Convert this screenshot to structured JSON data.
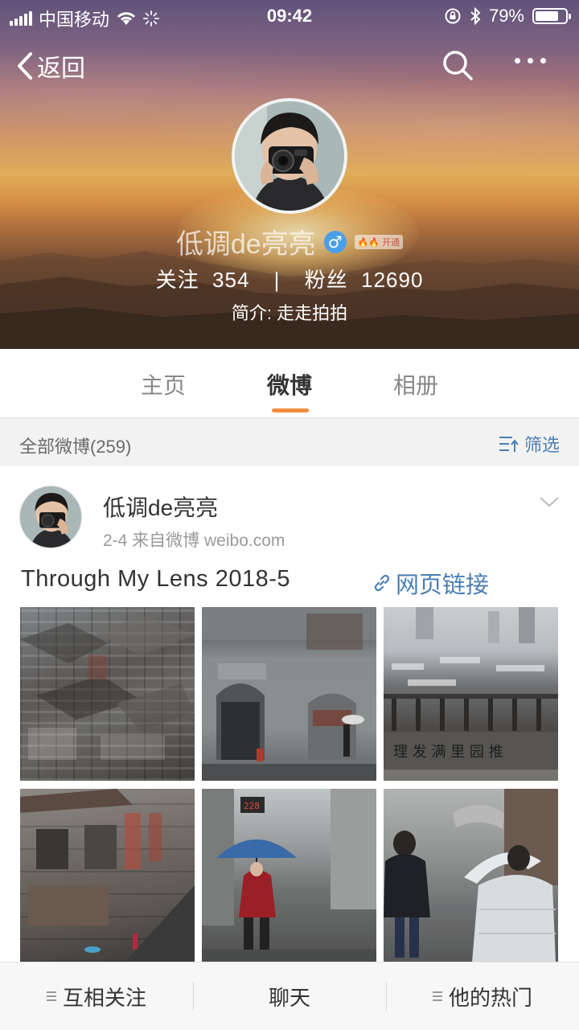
{
  "status_bar": {
    "carrier": "中国移动",
    "time": "09:42",
    "battery_percent": "79%",
    "battery_level": 0.79
  },
  "nav": {
    "back_label": "返回",
    "search_icon": "search-icon",
    "more_icon": "more-icon"
  },
  "profile": {
    "name": "低调de亮亮",
    "gender_symbol": "♂",
    "level_badge": "🔥🔥 开通",
    "following_label": "关注",
    "following_count": "354",
    "separator": "|",
    "followers_label": "粉丝",
    "followers_count": "12690",
    "bio": "简介: 走走拍拍"
  },
  "tabs": [
    {
      "label": "主页",
      "active": false
    },
    {
      "label": "微博",
      "active": true
    },
    {
      "label": "相册",
      "active": false
    }
  ],
  "filter": {
    "count_label": "全部微博(259)",
    "filter_label": "筛选"
  },
  "post": {
    "author": "低调de亮亮",
    "meta": "2-4  来自微博 weibo.com",
    "text": "Through My Lens 2018-5",
    "link_label": "网页链接",
    "photos": [
      "rooftops-photo",
      "gray-building-photo",
      "balcony-rooftops-photo",
      "old-buildings-photo",
      "umbrella-rain-photo",
      "alley-walkers-photo"
    ]
  },
  "bottom_bar": {
    "items": [
      {
        "label": "互相关注",
        "icon": "menu-icon"
      },
      {
        "label": "聊天",
        "icon": ""
      },
      {
        "label": "他的热门",
        "icon": "menu-icon"
      }
    ]
  },
  "colors": {
    "accent_orange": "#f08d3c",
    "link_blue": "#4a7fb5"
  }
}
